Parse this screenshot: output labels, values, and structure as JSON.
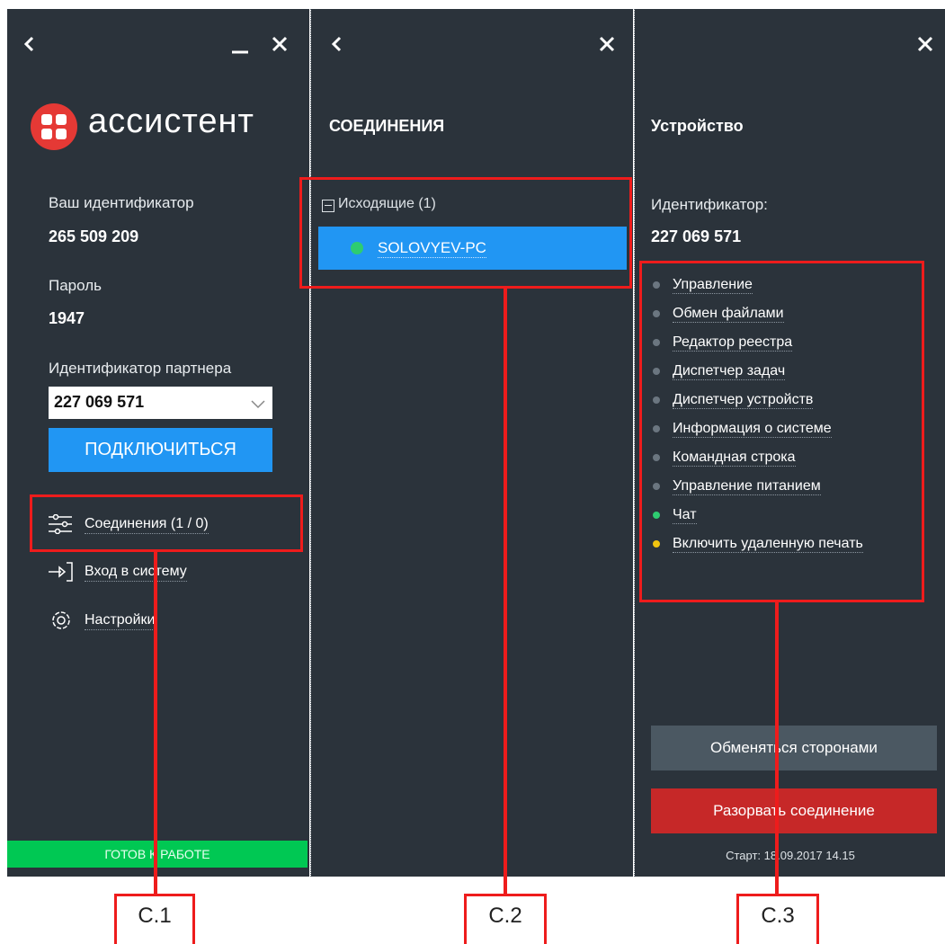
{
  "left_panel": {
    "back_icon": "chevron-left-icon",
    "minimize_icon": "minimize-icon",
    "close_icon": "close-icon",
    "logo_icon": "app-logo-icon",
    "app_name": "ассистент",
    "your_id_label": "Ваш идентификатор",
    "your_id_value": "265 509 209",
    "password_label": "Пароль",
    "password_value": "1947",
    "partner_id_label": "Идентификатор партнера",
    "partner_id_value": "227 069 571",
    "connect_button": "ПОДКЛЮЧИТЬСЯ",
    "menu": [
      {
        "icon": "sliders-icon",
        "label": "Соединения (1 / 0)"
      },
      {
        "icon": "login-icon",
        "label": "Вход в систему"
      },
      {
        "icon": "gear-icon",
        "label": "Настройки"
      }
    ],
    "status": "ГОТОВ К РАБОТЕ",
    "status_color": "#00c853"
  },
  "middle_panel": {
    "back_icon": "chevron-left-icon",
    "close_icon": "close-icon",
    "title": "СОЕДИНЕНИЯ",
    "group_label": "Исходящие (1)",
    "connection_name": "SOLOVYEV-PC",
    "connection_status_color": "#2ecc71",
    "selected_color": "#2196f3"
  },
  "right_panel": {
    "close_icon": "close-icon",
    "title": "Устройство",
    "id_label": "Идентификатор:",
    "id_value": "227 069 571",
    "features": [
      {
        "label": "Управление",
        "dot": "#6b7680"
      },
      {
        "label": "Обмен файлами",
        "dot": "#6b7680"
      },
      {
        "label": "Редактор реестра",
        "dot": "#6b7680"
      },
      {
        "label": "Диспетчер задач",
        "dot": "#6b7680"
      },
      {
        "label": "Диспетчер устройств",
        "dot": "#6b7680"
      },
      {
        "label": "Информация о системе",
        "dot": "#6b7680"
      },
      {
        "label": "Командная строка",
        "dot": "#6b7680"
      },
      {
        "label": "Управление питанием",
        "dot": "#6b7680"
      },
      {
        "label": "Чат",
        "dot": "#2ecc71"
      },
      {
        "label": "Включить удаленную печать",
        "dot": "#f1c40f"
      }
    ],
    "swap_button": "Обменяться сторонами",
    "disconnect_button": "Разорвать соединение",
    "start_text": "Старт: 18.09.2017 14.15"
  },
  "callouts": [
    "C.1",
    "C.2",
    "C.3"
  ]
}
